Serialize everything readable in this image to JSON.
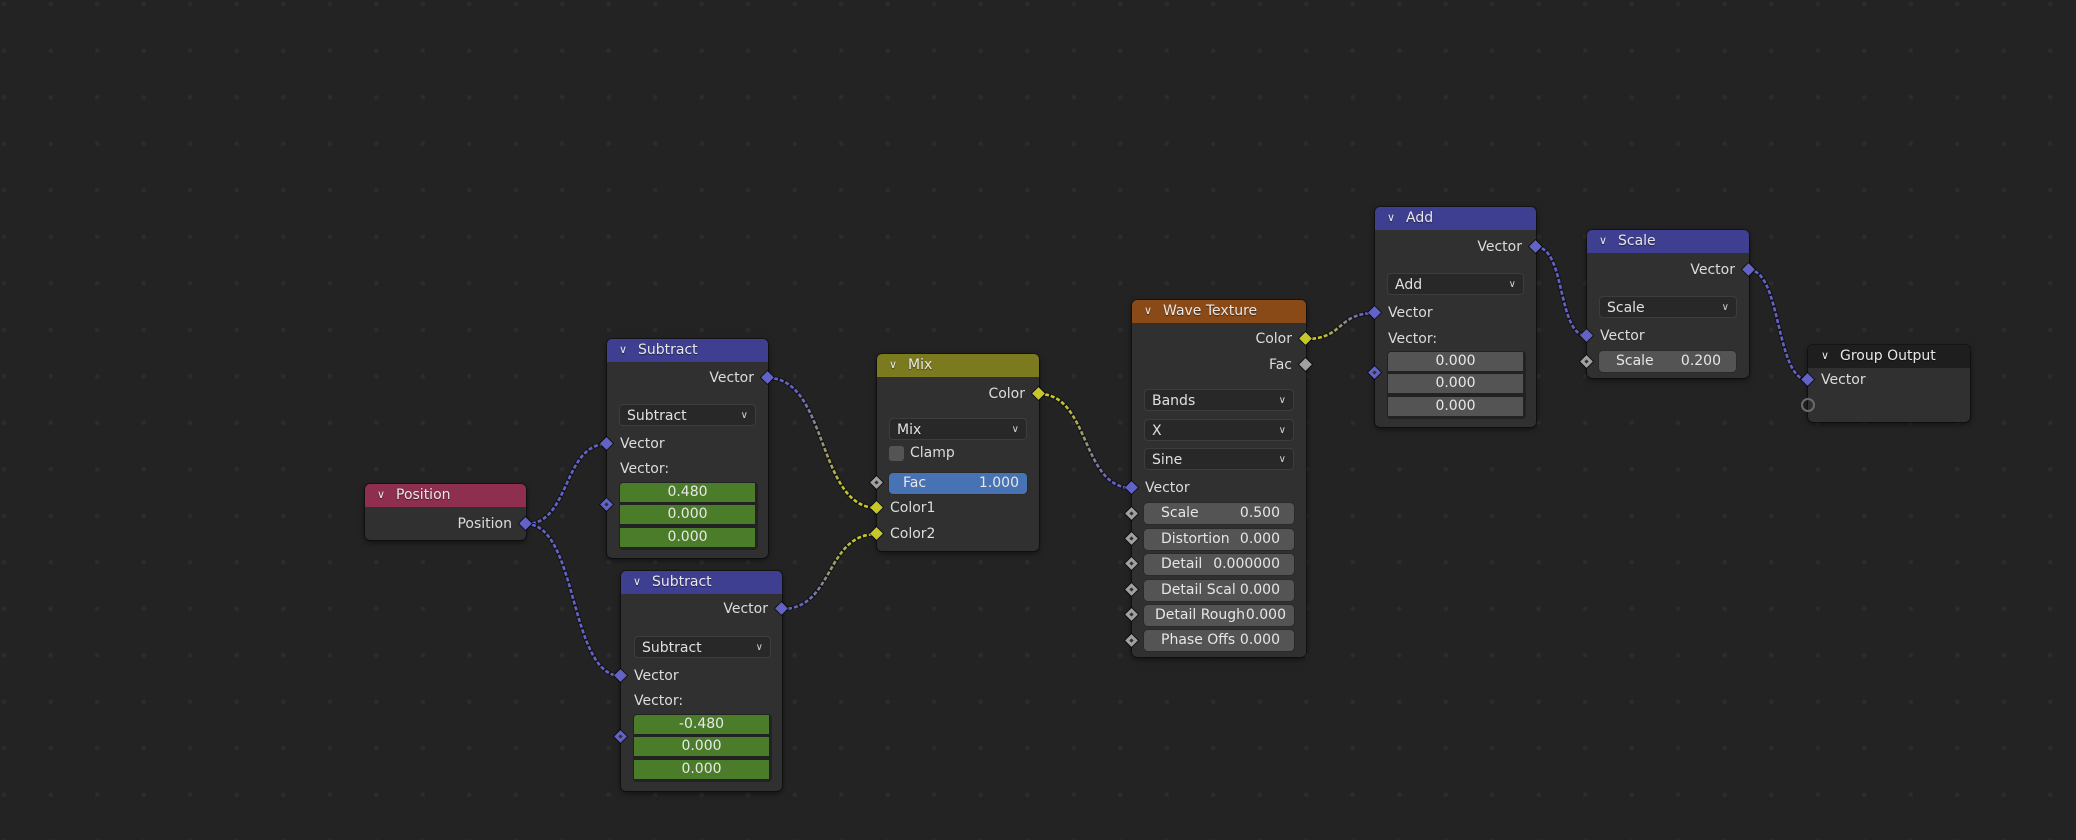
{
  "editor": "Node Editor",
  "colors": {
    "background": "#232323",
    "vector_socket": "#6363c7",
    "color_socket": "#c7c729",
    "float_socket": "#a1a1a1",
    "vector_header": "#3f3f92",
    "input_header": "#8f2f4f",
    "color_header": "#7b7a1e",
    "texture_header": "#8a4a18",
    "output_header": "#1e1e1e",
    "vector_field_green": "#4b7c2a",
    "factor_field": "#4772b3"
  },
  "nodes": {
    "position": {
      "title": "Position",
      "outputs": [
        "Position"
      ]
    },
    "subtract1": {
      "title": "Subtract",
      "output": "Vector",
      "operation": "Subtract",
      "input_socket": "Vector",
      "vector_label": "Vector:",
      "values": [
        "0.480",
        "0.000",
        "0.000"
      ]
    },
    "subtract2": {
      "title": "Subtract",
      "output": "Vector",
      "operation": "Subtract",
      "input_socket": "Vector",
      "vector_label": "Vector:",
      "values": [
        "-0.480",
        "0.000",
        "0.000"
      ]
    },
    "mix": {
      "title": "Mix",
      "output": "Color",
      "blend_mode": "Mix",
      "clamp_label": "Clamp",
      "clamp_checked": false,
      "fac_label": "Fac",
      "fac_value": "1.000",
      "inputs": [
        "Color1",
        "Color2"
      ]
    },
    "wave": {
      "title": "Wave Texture",
      "outputs": [
        "Color",
        "Fac"
      ],
      "wave_type": "Bands",
      "direction": "X",
      "profile": "Sine",
      "vector_input": "Vector",
      "fields": [
        {
          "label": "Scale",
          "value": "0.500"
        },
        {
          "label": "Distortion",
          "value": "0.000"
        },
        {
          "label": "Detail",
          "value": "0.000000"
        },
        {
          "label": "Detail Scal",
          "value": "0.000"
        },
        {
          "label": "Detail Rough",
          "value": "0.000"
        },
        {
          "label": "Phase Offs",
          "value": "0.000"
        }
      ]
    },
    "add": {
      "title": "Add",
      "output": "Vector",
      "operation": "Add",
      "input_socket": "Vector",
      "vector_label": "Vector:",
      "values": [
        "0.000",
        "0.000",
        "0.000"
      ]
    },
    "scale": {
      "title": "Scale",
      "output": "Vector",
      "operation": "Scale",
      "input_socket": "Vector",
      "scale_label": "Scale",
      "scale_value": "0.200"
    },
    "group_output": {
      "title": "Group Output",
      "inputs": [
        "Vector"
      ]
    }
  },
  "links": [
    {
      "from": "Position.Position",
      "to": "Subtract.Vector (top)",
      "from_color": "#6363c7",
      "to_color": "#6363c7"
    },
    {
      "from": "Position.Position",
      "to": "Subtract.Vector (bottom)",
      "from_color": "#6363c7",
      "to_color": "#6363c7"
    },
    {
      "from": "Subtract (top).Vector",
      "to": "Mix.Color1",
      "from_color": "#6363c7",
      "to_color": "#c7c729"
    },
    {
      "from": "Subtract (bottom).Vector",
      "to": "Mix.Color2",
      "from_color": "#6363c7",
      "to_color": "#c7c729"
    },
    {
      "from": "Mix.Color",
      "to": "Wave Texture.Vector",
      "from_color": "#c7c729",
      "to_color": "#6363c7"
    },
    {
      "from": "Wave Texture.Color",
      "to": "Add.Vector",
      "from_color": "#c7c729",
      "to_color": "#6363c7"
    },
    {
      "from": "Add.Vector",
      "to": "Scale.Vector",
      "from_color": "#6363c7",
      "to_color": "#6363c7"
    },
    {
      "from": "Scale.Vector",
      "to": "Group Output.Vector",
      "from_color": "#6363c7",
      "to_color": "#6363c7"
    }
  ]
}
